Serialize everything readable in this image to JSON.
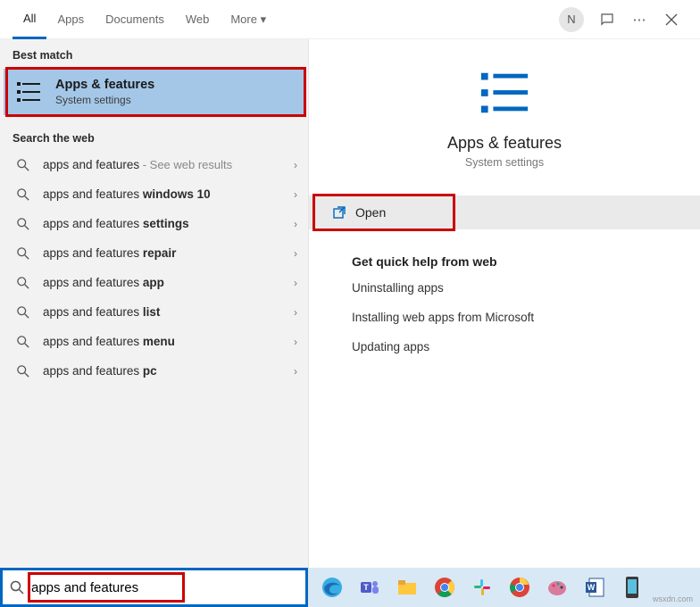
{
  "header": {
    "tabs": [
      "All",
      "Apps",
      "Documents",
      "Web",
      "More"
    ],
    "active_tab_index": 0,
    "user_initial": "N"
  },
  "left": {
    "best_match_label": "Best match",
    "best_match": {
      "title": "Apps & features",
      "subtitle": "System settings"
    },
    "web_label": "Search the web",
    "results": [
      {
        "prefix": "apps and features",
        "bold": "",
        "suffix": " - See web results"
      },
      {
        "prefix": "apps and features ",
        "bold": "windows 10",
        "suffix": ""
      },
      {
        "prefix": "apps and features ",
        "bold": "settings",
        "suffix": ""
      },
      {
        "prefix": "apps and features ",
        "bold": "repair",
        "suffix": ""
      },
      {
        "prefix": "apps and features ",
        "bold": "app",
        "suffix": ""
      },
      {
        "prefix": "apps and features ",
        "bold": "list",
        "suffix": ""
      },
      {
        "prefix": "apps and features ",
        "bold": "menu",
        "suffix": ""
      },
      {
        "prefix": "apps and features ",
        "bold": "pc",
        "suffix": ""
      }
    ]
  },
  "right": {
    "title": "Apps & features",
    "subtitle": "System settings",
    "open_label": "Open",
    "help_title": "Get quick help from web",
    "help_items": [
      "Uninstalling apps",
      "Installing web apps from Microsoft",
      "Updating apps"
    ]
  },
  "search": {
    "value": "apps and features"
  },
  "taskbar": {
    "icons": [
      "edge",
      "teams",
      "files",
      "chrome",
      "slack",
      "chrome2",
      "paint",
      "word",
      "phone"
    ]
  },
  "watermark": "wsxdn.com"
}
